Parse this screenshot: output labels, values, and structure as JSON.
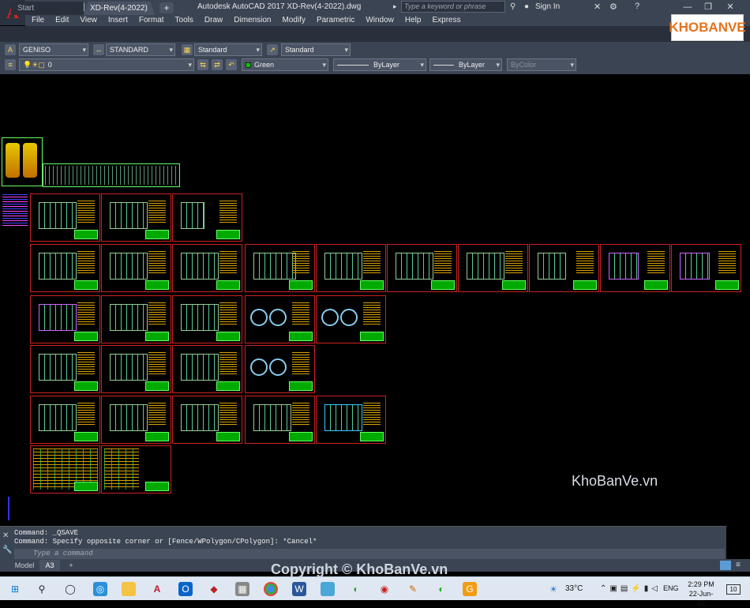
{
  "app": {
    "title": "Autodesk AutoCAD 2017    XD-Rev(4-2022).dwg",
    "logo_letter": "A",
    "search_placeholder": "Type a keyword or phrase",
    "signin": "Sign In"
  },
  "menu": [
    "File",
    "Edit",
    "View",
    "Insert",
    "Format",
    "Tools",
    "Draw",
    "Dimension",
    "Modify",
    "Parametric",
    "Window",
    "Help",
    "Express"
  ],
  "tabs": {
    "start": "Start",
    "document": "XD-Rev(4-2022)",
    "new_tab": "+"
  },
  "styles_row": {
    "text_style": "GENISO",
    "dim_style": "STANDARD",
    "table_style": "Standard",
    "mleader_style": "Standard"
  },
  "layer_row": {
    "layer": "0",
    "color": "Green",
    "linetype": "ByLayer",
    "lineweight": "ByLayer",
    "plotstyle": "ByColor"
  },
  "canvas": {
    "watermark": "KhoBanVe.vn"
  },
  "command": {
    "history": [
      "Command: _QSAVE",
      "Command: Specify opposite corner or [Fence/WPolygon/CPolygon]: *Cancel*"
    ],
    "placeholder": "Type a command"
  },
  "layouts": [
    "Model",
    "A3",
    "+"
  ],
  "overlay": {
    "copyright": "Copyright © KhoBanVe.vn",
    "brand_logo": "KHOBANVE"
  },
  "taskbar": {
    "temperature": "33°C",
    "language": "ENG",
    "time": "2:29 PM",
    "date": "22-Jun-22",
    "notifications": "10"
  },
  "colors": {
    "ui_dark": "#3b4453",
    "canvas": "#000000",
    "sheet_border": "#cc2222",
    "titleblock": "#00aa00"
  }
}
